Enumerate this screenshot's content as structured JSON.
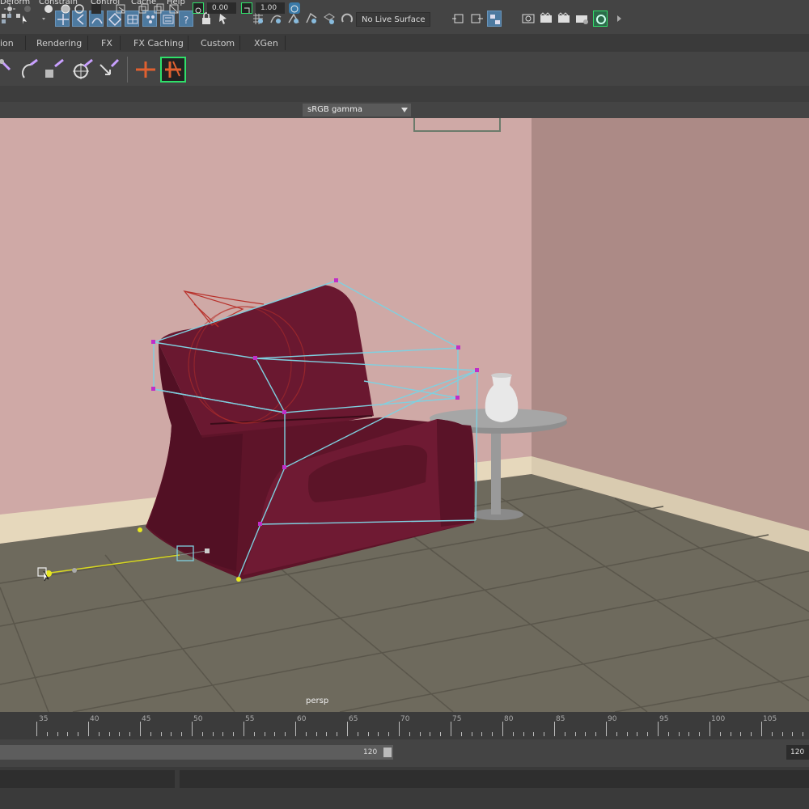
{
  "menu": {
    "items": [
      "Deform",
      "Constrain",
      "Control",
      "Cache",
      "Help"
    ]
  },
  "status_line": {
    "live_surface": "No Live Surface"
  },
  "shelf_tabs": [
    "ion",
    "Rendering",
    "FX",
    "FX Caching",
    "Custom",
    "XGen"
  ],
  "panel_toolbar": {
    "exposure": "0.00",
    "gamma": "1.00",
    "color_management": "sRGB gamma"
  },
  "viewport": {
    "camera": "persp"
  },
  "time_slider": {
    "ticks": [
      "35",
      "40",
      "45",
      "50",
      "55",
      "60",
      "65",
      "70",
      "75",
      "80",
      "85",
      "90",
      "95",
      "100",
      "105"
    ]
  },
  "range_slider": {
    "end_value": "120",
    "end_time": "120"
  },
  "colors": {
    "ui_bg": "#444444",
    "wall": "#cfa9a6",
    "floor": "#6f6b5e",
    "chair": "#6a1830",
    "handle": "#b83fc0",
    "lattice": "#7fd0e0"
  }
}
